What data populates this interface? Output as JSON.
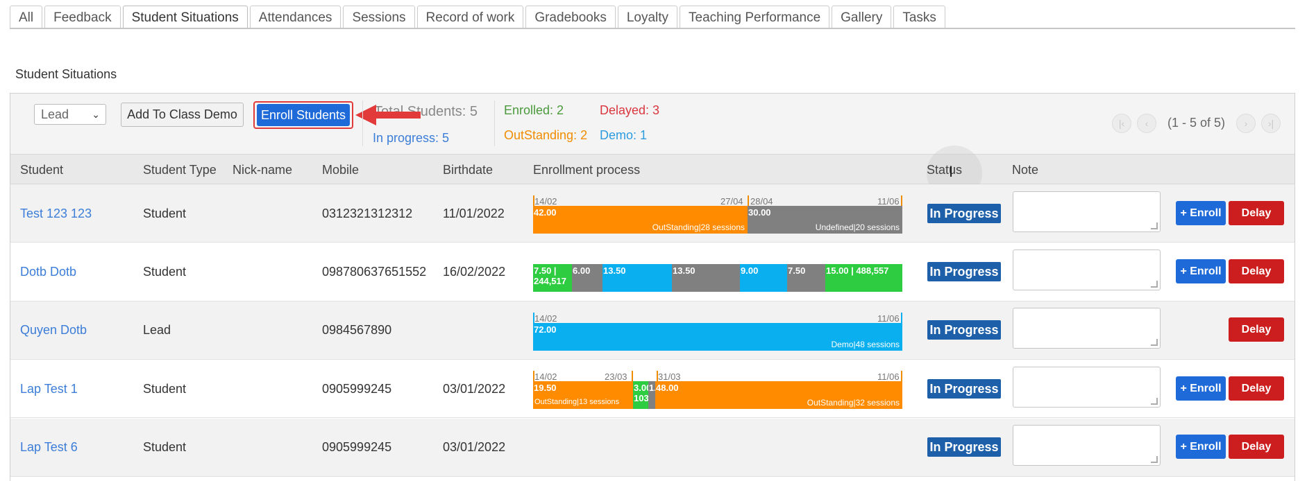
{
  "tabs": [
    "All",
    "Feedback",
    "Student Situations",
    "Attendances",
    "Sessions",
    "Record of work",
    "Gradebooks",
    "Loyalty",
    "Teaching Performance",
    "Gallery",
    "Tasks"
  ],
  "section_title": "Student Situations",
  "toolbar": {
    "type_select": "Lead",
    "add_demo_label": "Add To Class Demo",
    "enroll_label": "Enroll Students",
    "total_label": "Total Students: 5",
    "in_progress_label": "In progress: 5",
    "enrolled_label": "Enrolled: 2",
    "delayed_label": "Delayed: 3",
    "outstanding_label": "OutStanding: 2",
    "demo_label": "Demo: 1",
    "pager_label": "(1 - 5 of 5)"
  },
  "colors": {
    "enrolled": "#4a9a3c",
    "delayed": "#d9363e",
    "outstanding": "#f08c00",
    "demo": "#2d9be0",
    "orange_seg": "#ff8c00",
    "gray_seg": "#808080",
    "green_seg": "#2ecc40",
    "blue_seg": "#0aafef"
  },
  "columns": [
    "Student",
    "Student Type",
    "Nick-name",
    "Mobile",
    "Birthdate",
    "Enrollment process",
    "Status",
    "Note"
  ],
  "rows": [
    {
      "student": "Test 123 123",
      "type": "Student",
      "nick": "",
      "mobile": "0312321312312",
      "birthdate": "11/01/2022",
      "status": "In Progress",
      "has_enroll": true,
      "enroll_label": "+ Enroll",
      "delay_label": "Delay"
    },
    {
      "student": "Dotb Dotb",
      "type": "Student",
      "nick": "",
      "mobile": "098780637651552",
      "birthdate": "16/02/2022",
      "status": "In Progress",
      "has_enroll": true,
      "enroll_label": "+ Enroll",
      "delay_label": "Delay"
    },
    {
      "student": "Quyen Dotb",
      "type": "Lead",
      "nick": "",
      "mobile": "0984567890",
      "birthdate": "",
      "status": "In Progress",
      "has_enroll": false,
      "enroll_label": "",
      "delay_label": "Delay"
    },
    {
      "student": "Lap Test 1",
      "type": "Student",
      "nick": "",
      "mobile": "0905999245",
      "birthdate": "03/01/2022",
      "status": "In Progress",
      "has_enroll": true,
      "enroll_label": "+ Enroll",
      "delay_label": "Delay"
    },
    {
      "student": "Lap Test 6",
      "type": "Student",
      "nick": "",
      "mobile": "0905999245",
      "birthdate": "03/01/2022",
      "status": "In Progress",
      "has_enroll": true,
      "enroll_label": "+ Enroll",
      "delay_label": "Delay"
    }
  ],
  "enrollment": {
    "r1": {
      "dates": [
        "14/02",
        "27/04",
        "28/04",
        "11/06"
      ],
      "seg1": {
        "value": "42.00",
        "note": "OutStanding|28 sessions"
      },
      "seg2": {
        "value": "30.00",
        "note": "Undefined|20 sessions"
      }
    },
    "r2": {
      "segs": [
        "7.50 | 244,517",
        "6.00",
        "13.50",
        "13.50",
        "9.00",
        "7.50",
        "15.00 | 488,557"
      ]
    },
    "r3": {
      "dates": [
        "14/02",
        "11/06"
      ],
      "seg1": {
        "value": "72.00",
        "note": "Demo|48 sessions"
      }
    },
    "r4": {
      "dates": [
        "14/02",
        "23/03",
        "31/03",
        "11/06"
      ],
      "seg1": {
        "value": "19.50",
        "note": "OutStanding|13 sessions"
      },
      "seg2": {
        "value": "3.00"
      },
      "seg2b": "103",
      "seg3": {
        "value": "1."
      },
      "seg4": {
        "value": "48.00",
        "note": "OutStanding|32 sessions"
      }
    }
  }
}
